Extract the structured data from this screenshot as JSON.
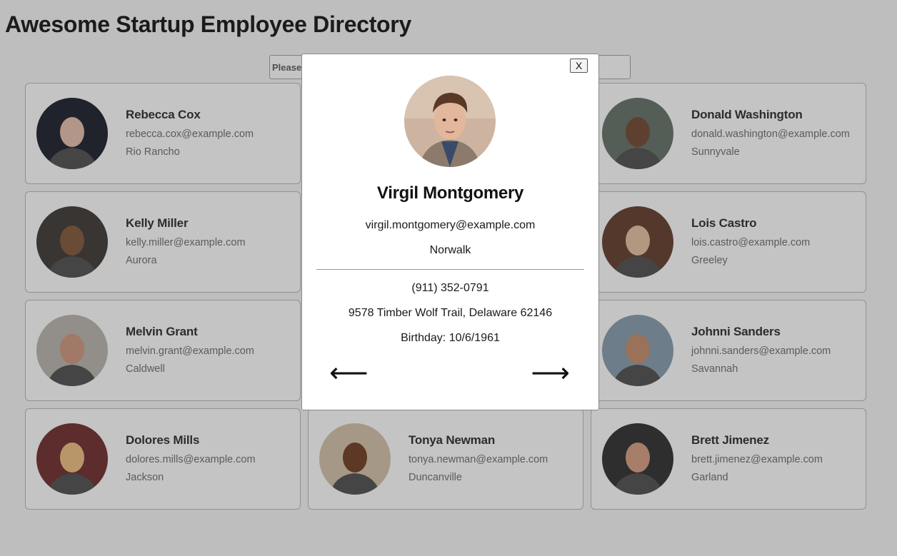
{
  "header": {
    "title": "Awesome Startup Employee Directory"
  },
  "search": {
    "placeholder": "Please enter a name to filter results"
  },
  "employees": [
    {
      "name": "Rebecca Cox",
      "email": "rebecca.cox@example.com",
      "city": "Rio Rancho",
      "avatar_colors": [
        "#2a2d3a",
        "#e8c4b4"
      ]
    },
    {
      "name": "",
      "email": "",
      "city": "",
      "avatar_colors": [
        "#888",
        "#ccc"
      ]
    },
    {
      "name": "Donald Washington",
      "email": "donald.washington@example.com",
      "city": "Sunnyvale",
      "avatar_colors": [
        "#6f7a72",
        "#7b5440"
      ]
    },
    {
      "name": "Kelly Miller",
      "email": "kelly.miller@example.com",
      "city": "Aurora",
      "avatar_colors": [
        "#4a4541",
        "#8b6245"
      ]
    },
    {
      "name": "",
      "email": "",
      "city": "",
      "avatar_colors": [
        "#888",
        "#ccc"
      ]
    },
    {
      "name": "Lois Castro",
      "email": "lois.castro@example.com",
      "city": "Greeley",
      "avatar_colors": [
        "#6e4a3a",
        "#e5c6a8"
      ]
    },
    {
      "name": "Melvin Grant",
      "email": "melvin.grant@example.com",
      "city": "Caldwell",
      "avatar_colors": [
        "#bfb9b3",
        "#d39c85"
      ]
    },
    {
      "name": "",
      "email": "",
      "city": "",
      "avatar_colors": [
        "#888",
        "#ccc"
      ]
    },
    {
      "name": "Johnni Sanders",
      "email": "johnni.sanders@example.com",
      "city": "Savannah",
      "avatar_colors": [
        "#8ea3b3",
        "#c99576"
      ]
    },
    {
      "name": "Dolores Mills",
      "email": "dolores.mills@example.com",
      "city": "Jackson",
      "avatar_colors": [
        "#7a3a3a",
        "#f0c38a"
      ]
    },
    {
      "name": "Tonya Newman",
      "email": "tonya.newman@example.com",
      "city": "Duncanville",
      "avatar_colors": [
        "#d8c6b0",
        "#7a4a30"
      ]
    },
    {
      "name": "Brett Jimenez",
      "email": "brett.jimenez@example.com",
      "city": "Garland",
      "avatar_colors": [
        "#3d3d3d",
        "#d9a48a"
      ]
    }
  ],
  "modal": {
    "close_label": "X",
    "name": "Virgil Montgomery",
    "email": "virgil.montgomery@example.com",
    "city": "Norwalk",
    "phone": "(911) 352-0791",
    "address": "9578 Timber Wolf Trail, Delaware 62146",
    "birthday": "Birthday: 10/6/1961",
    "prev_label": "⟵",
    "next_label": "⟶",
    "avatar_colors": [
      "#b89a88",
      "#5a3d30"
    ]
  }
}
